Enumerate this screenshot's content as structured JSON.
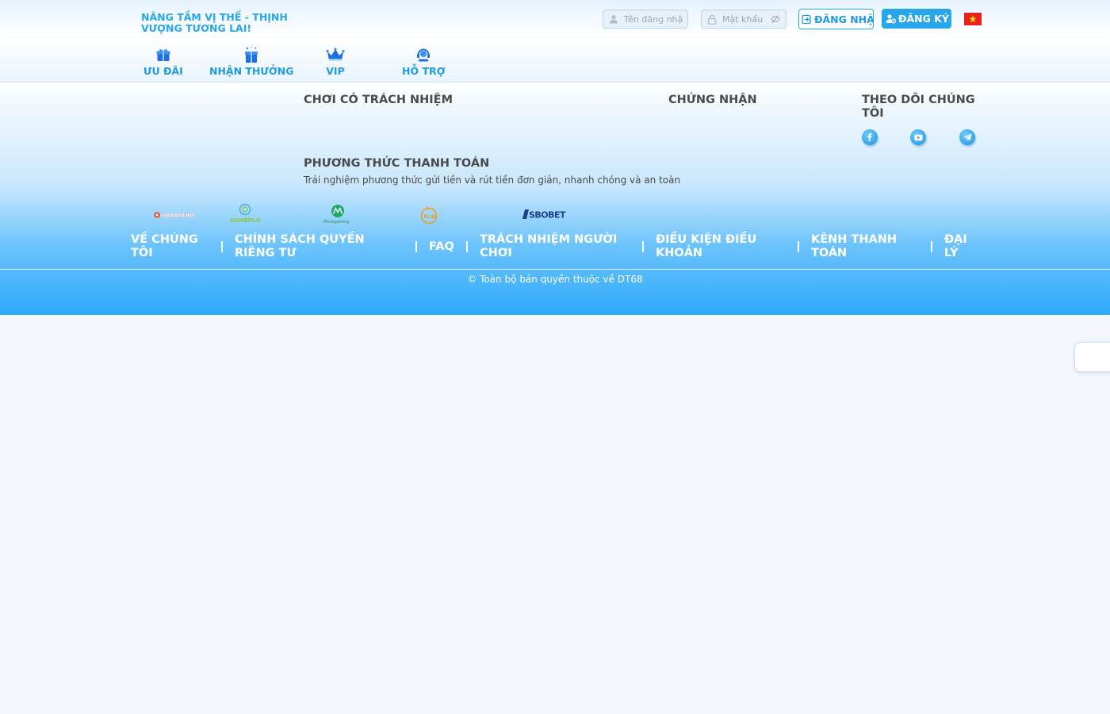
{
  "header": {
    "slogan": "NÂNG TẦM VỊ THẾ - THỊNH VƯỢNG TƯƠNG LAI!",
    "username_placeholder": "Tên đăng nhập",
    "password_placeholder": "Mật khẩu",
    "login_label": "ĐĂNG NHẬP",
    "register_label": "ĐĂNG KÝ",
    "language_flag": "vietnam-flag-icon"
  },
  "nav": {
    "items": [
      {
        "label": "ƯU ĐÃI",
        "icon": "gift-box-icon"
      },
      {
        "label": "NHẬN THƯỞNG",
        "icon": "reward-gift-icon"
      },
      {
        "label": "VIP",
        "icon": "crown-icon"
      },
      {
        "label": "HỖ TRỢ",
        "icon": "support-headset-icon"
      }
    ]
  },
  "footer": {
    "responsible_title": "CHƠI CÓ TRÁCH NHIỆM",
    "certification_title": "CHỨNG NHẬN",
    "follow_title": "THEO DÕI CHÚNG TÔI",
    "social": [
      "facebook-icon",
      "youtube-icon",
      "telegram-icon"
    ],
    "payment_title": "PHƯƠNG THỨC THANH TOÁN",
    "payment_desc": "Trải nghiệm phương thức gửi tiền và rút tiền đơn giản, nhanh chóng và an toàn",
    "providers": [
      "HABANERO",
      "GAMEPLAY",
      "Microgaming",
      "PLAY",
      "SBOBET"
    ],
    "links": [
      "VỀ CHÚNG TÔI",
      "CHÍNH SÁCH QUYỀN RIÊNG TƯ",
      "FAQ",
      "TRÁCH NHIỆM NGƯỜI CHƠI",
      "ĐIỀU KIỆN ĐIỀU KHOẢN",
      "KÊNH THANH TOÁN",
      "ĐẠI LÝ"
    ],
    "copyright": "© Toàn bộ bản quyền thuộc về DT68"
  },
  "colors": {
    "accent": "#27a7ea",
    "footer_bottom": "#2eaafc",
    "text_dark": "#4a4a4a"
  }
}
